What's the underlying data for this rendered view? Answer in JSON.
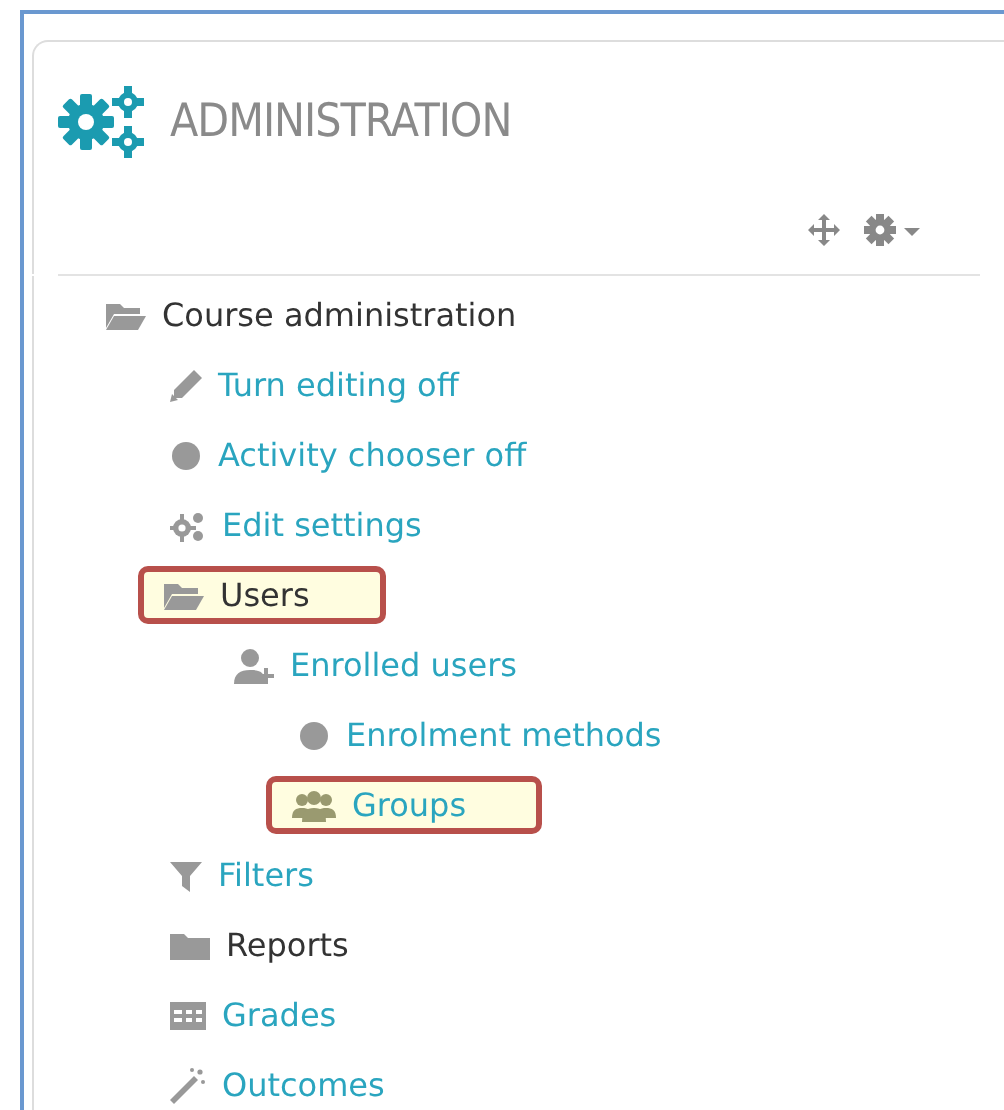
{
  "block": {
    "title": "ADMINISTRATION"
  },
  "tree": [
    {
      "label": "Course administration",
      "kind": "folder",
      "expanded": true,
      "highlighted": false,
      "children": [
        {
          "label": "Turn editing off",
          "kind": "pencil",
          "highlighted": false
        },
        {
          "label": "Activity chooser off",
          "kind": "dot",
          "highlighted": false
        },
        {
          "label": "Edit settings",
          "kind": "gears",
          "highlighted": false
        },
        {
          "label": "Users",
          "kind": "folder",
          "expanded": true,
          "highlighted": true,
          "children": [
            {
              "label": "Enrolled users",
              "kind": "user-plus",
              "highlighted": false,
              "children": [
                {
                  "label": "Enrolment methods",
                  "kind": "dot",
                  "highlighted": false
                },
                {
                  "label": "Groups",
                  "kind": "group",
                  "highlighted": true
                }
              ]
            }
          ]
        },
        {
          "label": "Filters",
          "kind": "filter",
          "highlighted": false
        },
        {
          "label": "Reports",
          "kind": "folder",
          "expanded": false,
          "highlighted": false
        },
        {
          "label": "Grades",
          "kind": "table",
          "highlighted": false
        },
        {
          "label": "Outcomes",
          "kind": "wand",
          "highlighted": false
        }
      ]
    }
  ]
}
